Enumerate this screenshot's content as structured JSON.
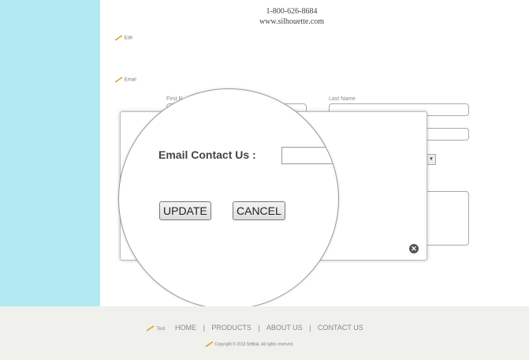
{
  "header": {
    "phone": "1-800-626-8684",
    "website": "www.silhouette.com"
  },
  "edit_links": {
    "edit": "Edit",
    "email": "Email"
  },
  "form": {
    "first_name_label": "First N",
    "last_name_label": "Last Name"
  },
  "dialog": {
    "label": "Email Contact Us :",
    "input_value": "",
    "update_label": "UPDATE",
    "cancel_label": "CANCEL",
    "close_glyph": "✕"
  },
  "footer": {
    "edit_label": "Text",
    "nav": [
      "HOME",
      "PRODUCTS",
      "ABOUT US",
      "CONTACT US"
    ],
    "separators": [
      "|",
      "|",
      "|"
    ],
    "copyright": "Copyright © 2013 SelBuk. All rights reserved."
  },
  "colors": {
    "sidebar": "#b3eaf2",
    "footer": "#f0f0ec",
    "pencil": "#e0a020"
  }
}
